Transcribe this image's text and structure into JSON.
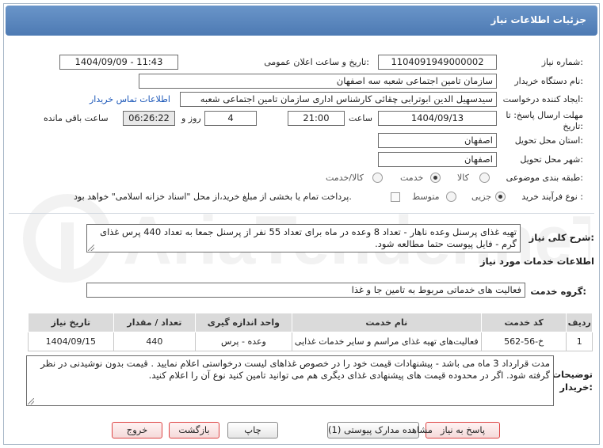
{
  "header": {
    "title": "جزئیات اطلاعات نیاز"
  },
  "fields": {
    "need_number_label": "شماره نیاز:",
    "need_number": "1104091949000002",
    "announce_label": "تاریخ و ساعت اعلان عمومی:",
    "announce_value": "1404/09/09 - 11:43",
    "buyer_org_label": "نام دستگاه خریدار:",
    "buyer_org": "سازمان تامین اجتماعی شعبه سه اصفهان",
    "creator_label": "ایجاد کننده درخواست:",
    "creator": "سیدسهیل الدین ابوترابی چقائی کارشناس اداری سازمان تامین اجتماعی شعبه",
    "contact_link": "اطلاعات تماس خریدار",
    "deadline_label": "مهلت ارسال پاسخ: تا تاریخ:",
    "deadline_date": "1404/09/13",
    "time_label": "ساعت",
    "deadline_time": "21:00",
    "days_value": "4",
    "days_label": "روز و",
    "remaining_value": "06:26:22",
    "remaining_label": "ساعت باقی مانده",
    "province_label": "استان محل تحویل:",
    "province": "اصفهان",
    "city_label": "شهر محل تحویل:",
    "city": "اصفهان",
    "category_label": "طبقه بندی موضوعی:",
    "category_options": [
      "کالا",
      "خدمت",
      "کالا/خدمت"
    ],
    "category_selected": "خدمت",
    "process_label": "نوع فرآیند خرید :",
    "process_options": [
      "جزیی",
      "متوسط"
    ],
    "process_selected": "جزیی",
    "payment_text": "پرداخت تمام یا بخشی از مبلغ خرید،از محل \"اسناد خزانه اسلامی\" خواهد بود."
  },
  "summary": {
    "label": "شرح کلی نیاز:",
    "text": "تهیه غذای پرسنل وعده ناهار - تعداد 8 وعده در ماه برای تعداد 55 نفر از پرسنل جمعا به تعداد 440 پرس غذای گرم - فایل پیوست حتما مطالعه شود."
  },
  "services": {
    "section_title": "اطلاعات خدمات مورد نیاز",
    "group_label": "گروه خدمت:",
    "group_value": "فعالیت های خدماتی مربوط به تامین جا و غذا",
    "columns": [
      "ردیف",
      "کد خدمت",
      "نام خدمت",
      "واحد اندازه گیری",
      "تعداد / مقدار",
      "تاریخ نیاز"
    ],
    "rows": [
      [
        "1",
        "خ-56-562",
        "فعالیت‌های تهیه غذای مراسم و سایر خدمات غذایی",
        "وعده - پرس",
        "440",
        "1404/09/15"
      ]
    ]
  },
  "notes": {
    "label": "توضیحات خریدار:",
    "text": "مدت قرارداد 3 ماه می باشد - پیشنهادات قیمت خود را در خصوص غذاهای لیست درخواستی اعلام نمایید . قیمت بدون نوشیدنی در نظر گرفته شود. اگر در محدوده قیمت های پیشنهادی غذای دیگری هم می توانید تامین کنید نوع آن را اعلام کنید."
  },
  "buttons": {
    "reply": "پاسخ به نیاز",
    "attachments": "مشاهده مدارک پیوستی (1)",
    "print": "چاپ",
    "back": "بازگشت",
    "exit": "خروج"
  },
  "watermark": "AriaTender.neT"
}
